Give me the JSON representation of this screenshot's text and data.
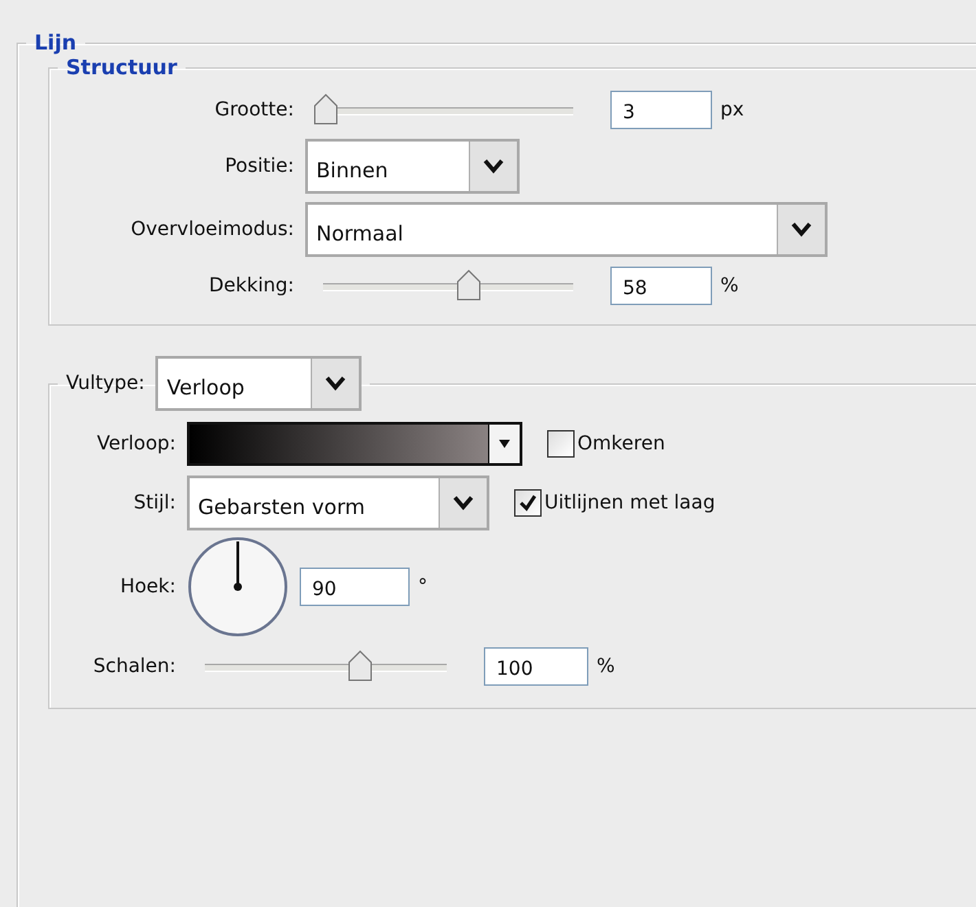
{
  "section": {
    "title": "Lijn"
  },
  "structure": {
    "title": "Structuur",
    "size": {
      "label": "Grootte:",
      "level": 0.01,
      "value": "3",
      "unit": "px"
    },
    "position": {
      "label": "Positie:",
      "value": "Binnen"
    },
    "blend_mode": {
      "label": "Overvloeimodus:",
      "value": "Normaal"
    },
    "opacity": {
      "label": "Dekking:",
      "level": 0.58,
      "value": "58",
      "unit": "%"
    }
  },
  "fill": {
    "label": "Vultype:",
    "value": "Verloop",
    "gradient": {
      "label": "Verloop:"
    },
    "reverse": {
      "label": "Omkeren",
      "checked": false
    },
    "style": {
      "label": "Stijl:",
      "value": "Gebarsten vorm"
    },
    "align": {
      "label": "Uitlijnen met laag",
      "checked": true
    },
    "angle": {
      "label": "Hoek:",
      "value": "90",
      "unit": "°"
    },
    "scale": {
      "label": "Schalen:",
      "level": 0.64,
      "value": "100",
      "unit": "%"
    }
  }
}
